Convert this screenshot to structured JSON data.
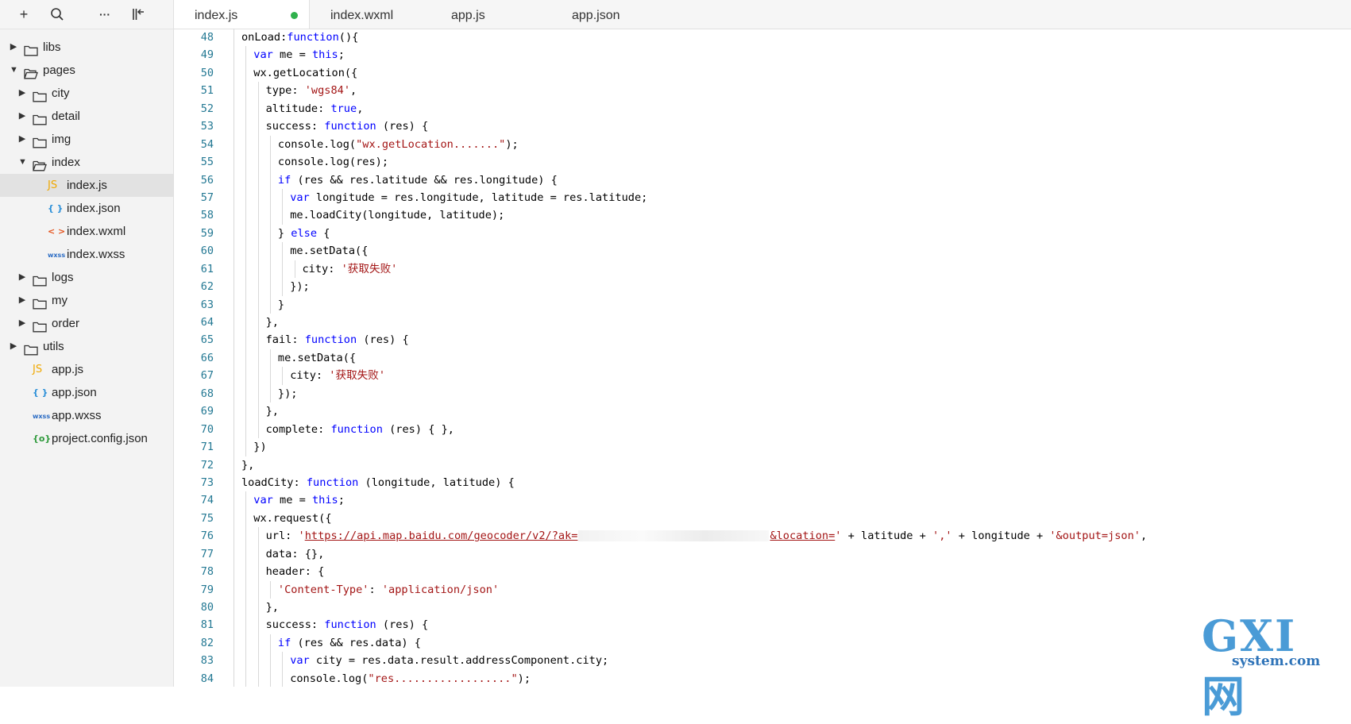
{
  "toolbar": {
    "add": "+",
    "search": "⌕",
    "more": "···",
    "collapse": "⊏"
  },
  "tree": {
    "libs": "libs",
    "pages": "pages",
    "city": "city",
    "detail": "detail",
    "img": "img",
    "index": "index",
    "index_js": "index.js",
    "index_json": "index.json",
    "index_wxml": "index.wxml",
    "index_wxss": "index.wxss",
    "logs": "logs",
    "my": "my",
    "order": "order",
    "utils": "utils",
    "app_js": "app.js",
    "app_json": "app.json",
    "app_wxss": "app.wxss",
    "project_config": "project.config.json"
  },
  "file_icons": {
    "js": "JS",
    "json": "{ }",
    "wxml": "< >",
    "wxss": "wxss",
    "config": "{o}"
  },
  "tabs": [
    "index.js",
    "index.wxml",
    "app.js",
    "app.json"
  ],
  "editor": {
    "line_numbers": [
      "48",
      "49",
      "50",
      "51",
      "52",
      "53",
      "54",
      "55",
      "56",
      "57",
      "58",
      "59",
      "60",
      "61",
      "62",
      "63",
      "64",
      "65",
      "66",
      "67",
      "68",
      "69",
      "70",
      "71",
      "72",
      "73",
      "74",
      "75",
      "76",
      "77",
      "78",
      "79",
      "80",
      "81",
      "82",
      "83",
      "84"
    ],
    "code": {
      "l48a": "onLoad:",
      "l48b": "function",
      "l48c": "(){",
      "l49a": "var",
      "l49b": " me = ",
      "l49c": "this",
      "l49d": ";",
      "l50": "wx.getLocation({",
      "l51a": "type",
      "l51b": ": ",
      "l51c": "'wgs84'",
      "l51d": ",",
      "l52a": "altitude: ",
      "l52b": "true",
      "l52c": ",",
      "l53a": "success: ",
      "l53b": "function",
      "l53c": " (res) {",
      "l54a": "console.log(",
      "l54b": "\"wx.getLocation.......\"",
      "l54c": ");",
      "l55": "console.log(res);",
      "l56a": "if",
      "l56b": " (res && res.latitude && res.longitude) {",
      "l57a": "var",
      "l57b": " longitude = res.longitude, latitude = res.latitude;",
      "l58": "me.loadCity(longitude, latitude);",
      "l59a": "} ",
      "l59b": "else",
      "l59c": " {",
      "l60": "me.setData({",
      "l61a": "city: ",
      "l61b": "'获取失败'",
      "l62": "});",
      "l63": "}",
      "l64": "},",
      "l65a": "fail: ",
      "l65b": "function",
      "l65c": " (res) {",
      "l66": "me.setData({",
      "l67a": "city: ",
      "l67b": "'获取失败'",
      "l68": "});",
      "l69": "},",
      "l70a": "complete: ",
      "l70b": "function",
      "l70c": " (res) { },",
      "l71": "})",
      "l72": "},",
      "l73a": "loadCity: ",
      "l73b": "function",
      "l73c": " (longitude, latitude) {",
      "l74a": "var",
      "l74b": " me = ",
      "l74c": "this",
      "l74d": ";",
      "l75": "wx.request({",
      "l76a": "url: ",
      "l76b": "'",
      "l76c": "https://api.map.baidu.com/geocoder/v2/?ak=",
      "l76d": "&location=",
      "l76e": "'",
      "l76f": " + latitude + ",
      "l76g": "','",
      "l76h": " + longitude + ",
      "l76i": "'&output=json'",
      "l76j": ",",
      "l77": "data: {},",
      "l78": "header: {",
      "l79a": "'Content-Type'",
      "l79b": ": ",
      "l79c": "'application/json'",
      "l80": "},",
      "l81a": "success: ",
      "l81b": "function",
      "l81c": " (res) {",
      "l82a": "if",
      "l82b": " (res && res.data) {",
      "l83a": "var",
      "l83b": " city = res.data.result.addressComponent.city;",
      "l84a": "console.log(",
      "l84b": "\"res..................\"",
      "l84c": ");"
    }
  },
  "watermark": {
    "big": "GXI网",
    "sub": "system.com"
  }
}
